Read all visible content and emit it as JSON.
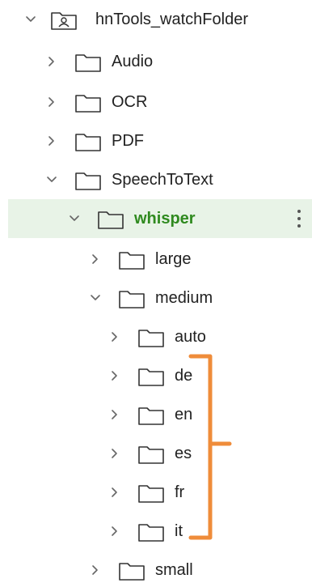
{
  "colors": {
    "accent": "#2f8a1f",
    "selected_background": "#e8f3e7",
    "text": "#222222",
    "icon_stroke": "#333333",
    "chevron": "#666666",
    "annotation_bracket": "#ef8c3a"
  },
  "tree": {
    "root": {
      "label": "hnTools_watchFolder",
      "icon": "shared-folder-icon",
      "expanded": true
    },
    "items": [
      {
        "label": "Audio",
        "icon": "folder-icon",
        "expanded": false
      },
      {
        "label": "OCR",
        "icon": "folder-icon",
        "expanded": false
      },
      {
        "label": "PDF",
        "icon": "folder-icon",
        "expanded": false
      },
      {
        "label": "SpeechToText",
        "icon": "folder-icon",
        "expanded": true
      },
      {
        "label": "whisper",
        "icon": "folder-icon",
        "expanded": true,
        "selected": true,
        "has_menu": true
      },
      {
        "label": "large",
        "icon": "folder-icon",
        "expanded": false
      },
      {
        "label": "medium",
        "icon": "folder-icon",
        "expanded": true
      },
      {
        "label": "auto",
        "icon": "folder-icon",
        "expanded": false
      },
      {
        "label": "de",
        "icon": "folder-icon",
        "expanded": false
      },
      {
        "label": "en",
        "icon": "folder-icon",
        "expanded": false
      },
      {
        "label": "es",
        "icon": "folder-icon",
        "expanded": false
      },
      {
        "label": "fr",
        "icon": "folder-icon",
        "expanded": false
      },
      {
        "label": "it",
        "icon": "folder-icon",
        "expanded": false
      },
      {
        "label": "small",
        "icon": "folder-icon",
        "expanded": false
      }
    ]
  },
  "annotation": {
    "type": "curly-bracket",
    "spans": [
      "de",
      "en",
      "es",
      "fr",
      "it"
    ]
  }
}
